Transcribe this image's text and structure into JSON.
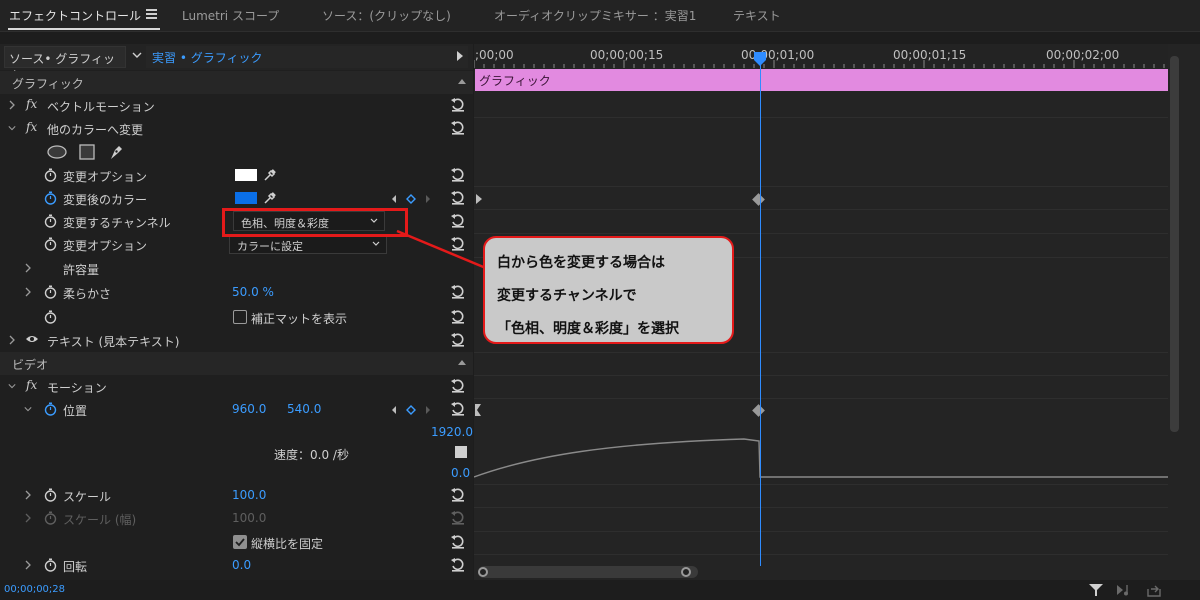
{
  "tabs": [
    {
      "label": "エフェクトコントロール",
      "active": true
    },
    {
      "label": "Lumetri スコープ"
    },
    {
      "label": "ソース：(クリップなし)"
    },
    {
      "label": "オーディオクリップミキサー ：実習1"
    },
    {
      "label": "テキスト"
    }
  ],
  "source_bar": {
    "source": "ソース• グラフィック",
    "target": "実習 • グラフィック"
  },
  "timeline": {
    "timecodes": [
      ";00;00",
      "00;00;00;15",
      "00;00;01;00",
      "00;00;01;15",
      "00;00;02;00"
    ],
    "clip_label": "グラフィック",
    "curve_top": "1920.0",
    "curve_bottom": "0.0"
  },
  "sections": {
    "graphics": "グラフィック",
    "video": "ビデオ"
  },
  "effects": {
    "vector_motion": "ベクトルモーション",
    "change_to_color": "他のカラーへ変更",
    "text_layer": "テキスト (見本テキスト)",
    "motion": "モーション"
  },
  "props": {
    "from_color": "変更オプション",
    "to_color": "変更後のカラー",
    "channel": "変更するチャンネル",
    "change_option": "変更オプション",
    "tolerance": "許容量",
    "softness": "柔らかさ",
    "position": "位置",
    "velocity": "速度：0.0 /秒",
    "scale": "スケール",
    "scale_width": "スケール (幅)",
    "rotation": "回転",
    "show_matte": "補正マットを表示",
    "lock_aspect": "縦横比を固定"
  },
  "values": {
    "channel": "色相、明度＆彩度",
    "change_option": "カラーに設定",
    "softness": "50.0 %",
    "position_x": "960.0",
    "position_y": "540.0",
    "scale": "100.0",
    "scale_width": "100.0",
    "rotation": "0.0",
    "from_color_hex": "#ffffff",
    "to_color_hex": "#0a6fe8"
  },
  "bottom": {
    "timecode": "00;00;00;28"
  },
  "callout": {
    "line1": "白から色を変更する場合は",
    "line2": "変更するチャンネルで",
    "line3": "「色相、明度＆彩度」を選択"
  }
}
